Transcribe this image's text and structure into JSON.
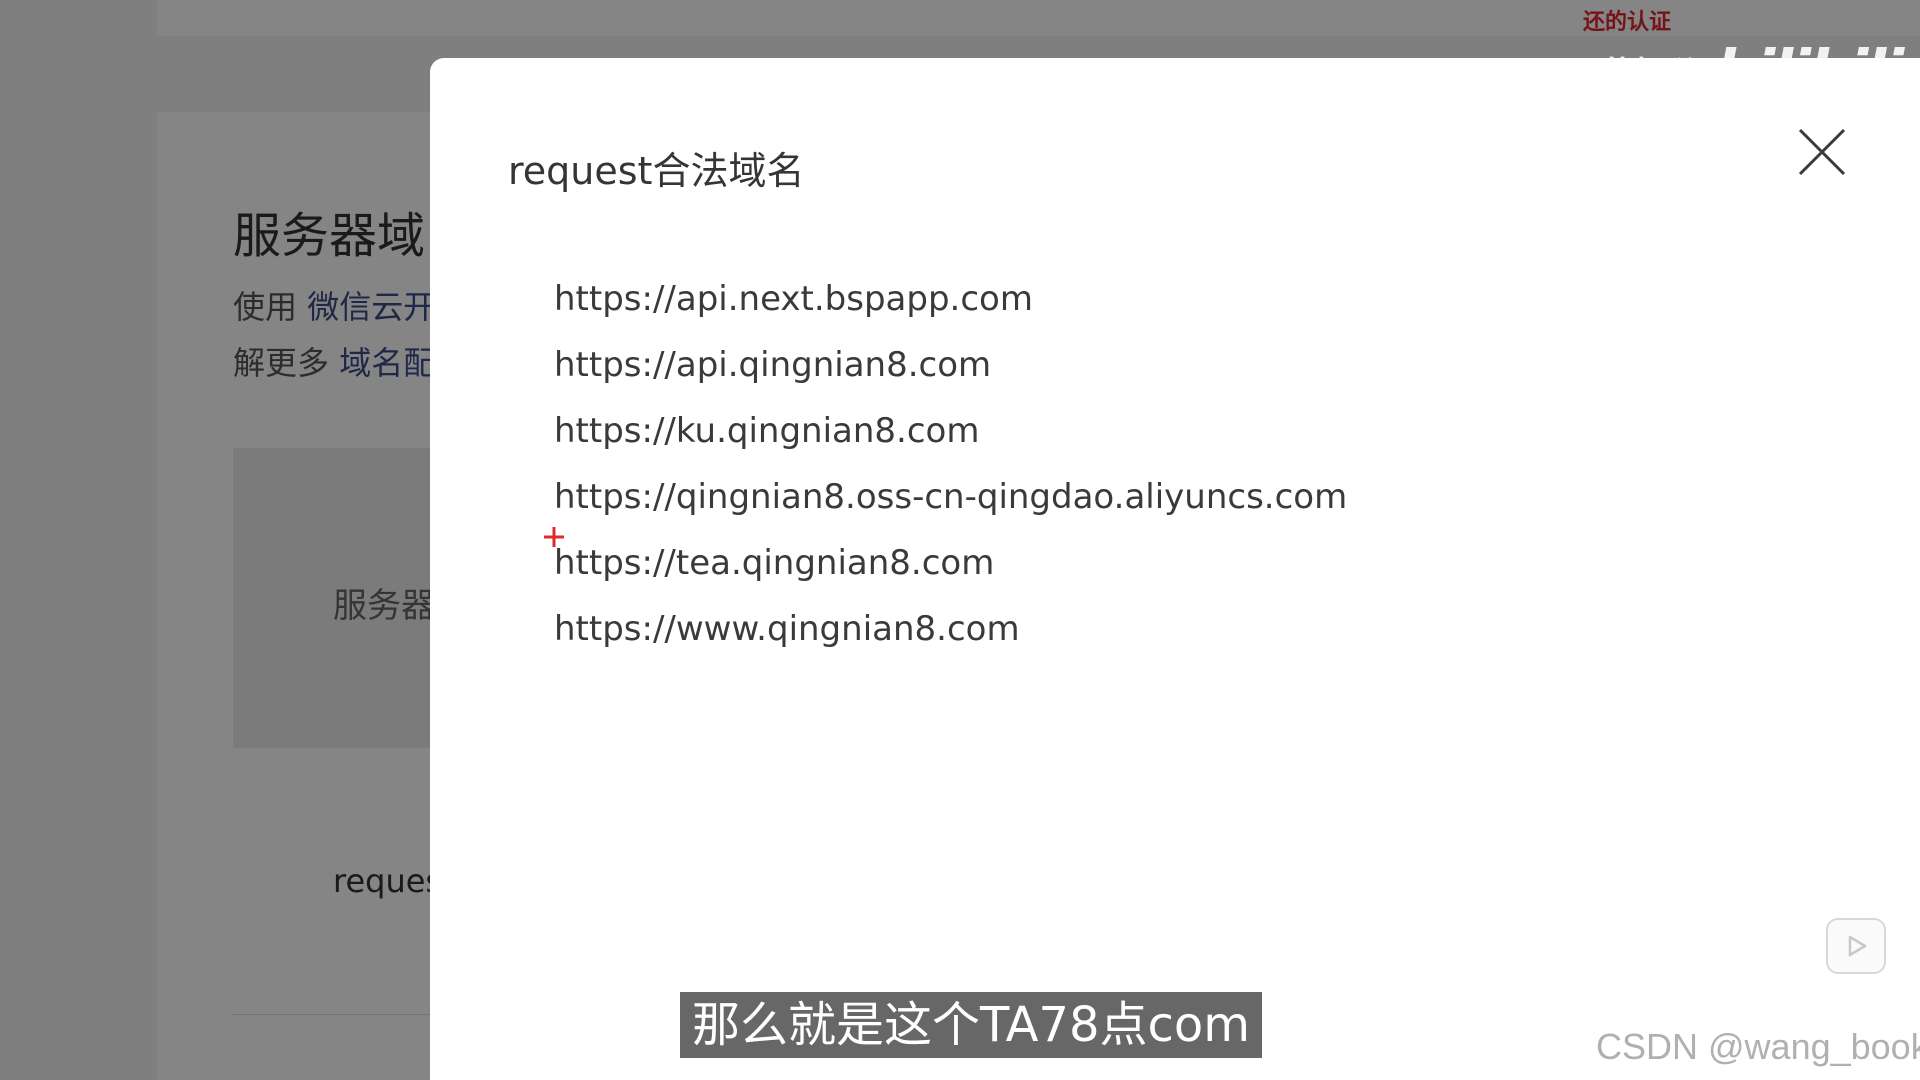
{
  "background": {
    "topbar_notice": "还的认证",
    "heading": "服务器域",
    "line1_prefix": "使用",
    "line1_link": "微信云开",
    "line2_prefix": "解更多",
    "line2_link": "域名配",
    "table_label": "服务器",
    "row_label": "reques"
  },
  "watermark": {
    "uploader": "黄枫谷",
    "logo": "bilibili"
  },
  "modal": {
    "title": "request合法域名",
    "domains": [
      "https://api.next.bspapp.com",
      "https://api.qingnian8.com",
      "https://ku.qingnian8.com",
      "https://qingnian8.oss-cn-qingdao.aliyuncs.com",
      "https://tea.qingnian8.com",
      "https://www.qingnian8.com"
    ]
  },
  "subtitle": "那么就是这个TA78点com",
  "csdn_watermark": "CSDN @wang_book",
  "colors": {
    "link": "#3f4e8a",
    "warning": "#e0282e",
    "cursor": "#e0282e"
  }
}
